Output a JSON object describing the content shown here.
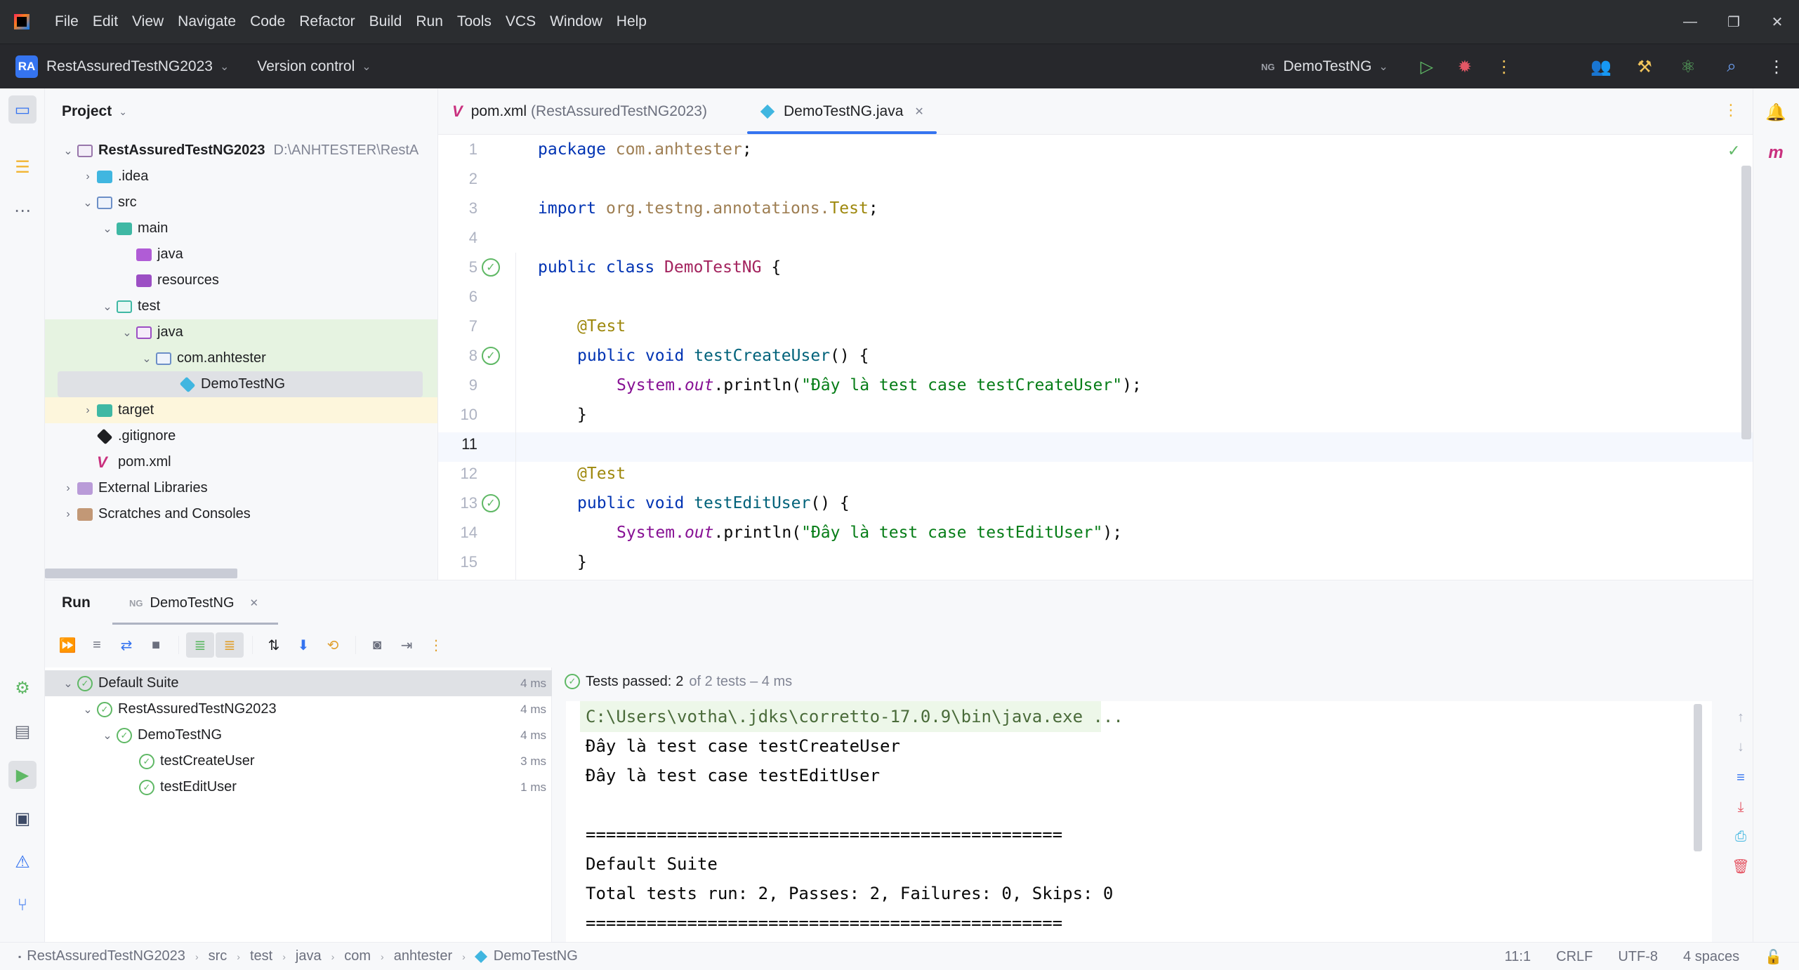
{
  "menubar": {
    "items": [
      "File",
      "Edit",
      "View",
      "Navigate",
      "Code",
      "Refactor",
      "Build",
      "Run",
      "Tools",
      "VCS",
      "Window",
      "Help"
    ],
    "window_controls": [
      "—",
      "❐",
      "✕"
    ]
  },
  "toolbar": {
    "project_badge": "RA",
    "project_name": "RestAssuredTestNG2023",
    "vcs_label": "Version control",
    "run_config_icon": "NG",
    "run_config_name": "DemoTestNG",
    "icons": [
      "run-icon",
      "debug-icon",
      "more-icon",
      "collab-icon",
      "build-tools-icon",
      "ai-icon",
      "search-icon",
      "settings-icon"
    ]
  },
  "project": {
    "title": "Project",
    "tree": [
      {
        "label": "RestAssuredTestNG2023",
        "path": "D:\\ANHTESTER\\RestA",
        "bold": true
      },
      {
        "label": ".idea"
      },
      {
        "label": "src"
      },
      {
        "label": "main"
      },
      {
        "label": "java"
      },
      {
        "label": "resources"
      },
      {
        "label": "test"
      },
      {
        "label": "java"
      },
      {
        "label": "com.anhtester"
      },
      {
        "label": "DemoTestNG"
      },
      {
        "label": "target"
      },
      {
        "label": ".gitignore"
      },
      {
        "label": "pom.xml"
      },
      {
        "label": "External Libraries"
      },
      {
        "label": "Scratches and Consoles"
      }
    ]
  },
  "editor": {
    "tabs": [
      {
        "label": "pom.xml",
        "sub": "(RestAssuredTestNG2023)"
      },
      {
        "label": "DemoTestNG.java",
        "close": "✕"
      }
    ],
    "line_numbers": [
      "1",
      "2",
      "3",
      "4",
      "5",
      "6",
      "7",
      "8",
      "9",
      "10",
      "11",
      "12",
      "13",
      "14",
      "15"
    ],
    "code": {
      "l1_kw": "package",
      "l1_pkg": "com.anhtester",
      "l1_end": ";",
      "l3_kw": "import",
      "l3_pkg": "org.testng.annotations.",
      "l3_cls": "Test",
      "l3_end": ";",
      "l5_kw": "public class",
      "l5_cls": "DemoTestNG",
      "l5_end": " {",
      "l7_ann": "@Test",
      "l8_kw": "public void",
      "l8_mth": "testCreateUser",
      "l8_end": "() {",
      "l9_sys": "System.",
      "l9_out": "out",
      "l9_call": ".println(",
      "l9_str": "\"Đây là test case testCreateUser\"",
      "l9_end": ");",
      "l10": "}",
      "l12_ann": "@Test",
      "l13_kw": "public void",
      "l13_mth": "testEditUser",
      "l13_end": "() {",
      "l14_sys": "System.",
      "l14_out": "out",
      "l14_call": ".println(",
      "l14_str": "\"Đây là test case testEditUser\"",
      "l14_end": ");",
      "l15": "}"
    }
  },
  "run": {
    "title": "Run",
    "tab_icon": "NG",
    "tab_label": "DemoTestNG",
    "tab_close": "✕",
    "tests": [
      {
        "label": "Default Suite",
        "time": "4 ms"
      },
      {
        "label": "RestAssuredTestNG2023",
        "time": "4 ms"
      },
      {
        "label": "DemoTestNG",
        "time": "4 ms"
      },
      {
        "label": "testCreateUser",
        "time": "3 ms"
      },
      {
        "label": "testEditUser",
        "time": "1 ms"
      }
    ],
    "status_label": "Tests passed:",
    "status_count": "2",
    "status_detail": "of 2 tests – 4 ms",
    "console": [
      "C:\\Users\\votha\\.jdks\\corretto-17.0.9\\bin\\java.exe ...",
      "Đây là test case testCreateUser",
      "Đây là test case testEditUser",
      "",
      "===============================================",
      "Default Suite",
      "Total tests run: 2, Passes: 2, Failures: 0, Skips: 0",
      "==============================================="
    ]
  },
  "statusbar": {
    "breadcrumbs": [
      "RestAssuredTestNG2023",
      "src",
      "test",
      "java",
      "com",
      "anhtester",
      "DemoTestNG"
    ],
    "position": "11:1",
    "line_sep": "CRLF",
    "encoding": "UTF-8",
    "indent": "4 spaces"
  },
  "colors": {
    "accent": "#3574f0",
    "success": "#5fb865",
    "dark_bar": "#2b2d30"
  }
}
